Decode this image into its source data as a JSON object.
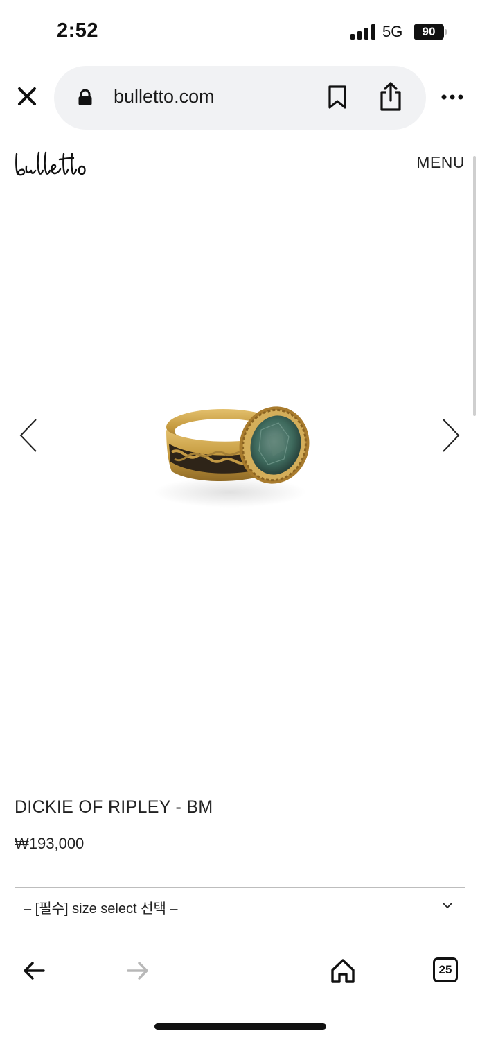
{
  "status_bar": {
    "time": "2:52",
    "network": "5G",
    "battery": "90"
  },
  "browser": {
    "url": "bulletto.com",
    "icons": [
      "close-icon",
      "lock-icon",
      "bookmark-icon",
      "share-icon",
      "more-icon"
    ]
  },
  "site": {
    "logo_text": "bulletto",
    "menu_label": "MENU"
  },
  "product": {
    "name": "DICKIE OF RIPLEY - BM",
    "price": "₩193,000",
    "size_select": "– [필수] size select 선택 –"
  },
  "toolbar": {
    "tab_count": "25",
    "icons": [
      "back-arrow-icon",
      "forward-arrow-icon",
      "home-icon",
      "tabs-icon"
    ]
  },
  "colors": {
    "url_bar_bg": "#f1f2f4",
    "text": "#111111",
    "disabled": "#b8b8b8",
    "gold": "#c9a24a",
    "gem": "#3f6b5e"
  }
}
